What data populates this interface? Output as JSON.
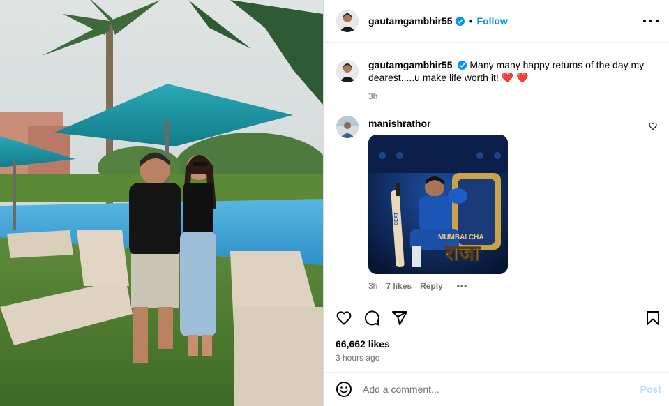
{
  "post": {
    "author": "gautamgambhir55",
    "verified": true,
    "separator": "•",
    "follow_label": "Follow",
    "caption": "Many many happy returns of the day my dearest.....u make life worth it!",
    "caption_emoji": "❤️ ❤️",
    "caption_time": "3h"
  },
  "comment": {
    "author": "manishrathor_",
    "gif_overlay_small": "MUMBAI CHA",
    "gif_overlay_big": "राजा",
    "bat_brand": "CEAT",
    "time": "3h",
    "likes": "7 likes",
    "reply_label": "Reply",
    "more_label": "•••"
  },
  "actions": {
    "like_count": "66,662 likes",
    "posted_ago": "3 hours ago"
  },
  "composer": {
    "placeholder": "Add a comment...",
    "post_label": "Post"
  },
  "icons": [
    "verified-badge-icon",
    "more-options-icon",
    "heart-icon",
    "comment-icon",
    "share-icon",
    "bookmark-icon",
    "emoji-icon"
  ],
  "colors": {
    "link_blue": "#0095f6",
    "post_disabled": "#b2dffc",
    "heart_red": "#e0245e",
    "muted_text": "#737373"
  }
}
